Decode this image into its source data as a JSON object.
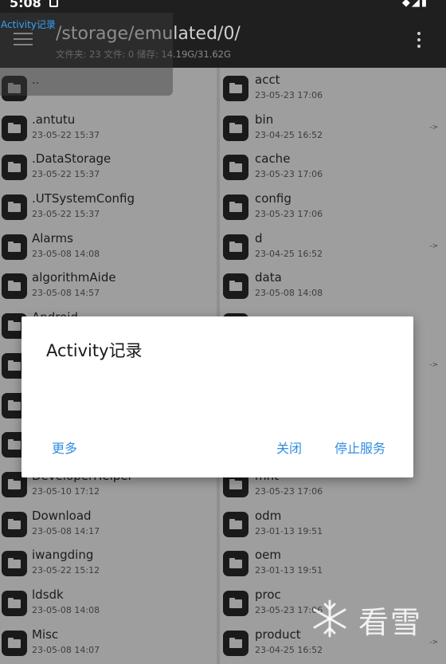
{
  "status_bar": {
    "time": "5:08"
  },
  "toolbar": {
    "path": "/storage/emulated/0/",
    "summary": "文件夹: 23  文件: 0  储存: 14.19G/31.62G"
  },
  "overlay": {
    "label": "Activity记录"
  },
  "left_list": [
    {
      "name": "..",
      "date": ""
    },
    {
      "name": ".antutu",
      "date": "23-05-22 15:37"
    },
    {
      "name": ".DataStorage",
      "date": "23-05-22 15:37"
    },
    {
      "name": ".UTSystemConfig",
      "date": "23-05-22 15:37"
    },
    {
      "name": "Alarms",
      "date": "23-05-08 14:08"
    },
    {
      "name": "algorithmAide",
      "date": "23-05-08 14:57"
    },
    {
      "name": "Android",
      "date": ""
    },
    {
      "name": "",
      "date": ""
    },
    {
      "name": "",
      "date": ""
    },
    {
      "name": "",
      "date": ""
    },
    {
      "name": "DeveloperHelper",
      "date": "23-05-10 17:12"
    },
    {
      "name": "Download",
      "date": "23-05-08 14:17"
    },
    {
      "name": "iwangding",
      "date": "23-05-22 15:12"
    },
    {
      "name": "ldsdk",
      "date": "23-05-08 14:08"
    },
    {
      "name": "Misc",
      "date": "23-05-08 14:07"
    }
  ],
  "right_list": [
    {
      "name": "acct",
      "date": "23-05-23 17:06",
      "arrow": ""
    },
    {
      "name": "bin",
      "date": "23-04-25 16:52",
      "arrow": "->"
    },
    {
      "name": "cache",
      "date": "23-05-23 17:06",
      "arrow": ""
    },
    {
      "name": "config",
      "date": "23-05-23 17:06",
      "arrow": ""
    },
    {
      "name": "d",
      "date": "23-04-25 16:52",
      "arrow": "->"
    },
    {
      "name": "data",
      "date": "23-05-08 14:08",
      "arrow": ""
    },
    {
      "name": "",
      "date": "",
      "arrow": ""
    },
    {
      "name": "",
      "date": "",
      "arrow": "->"
    },
    {
      "name": "",
      "date": "",
      "arrow": ""
    },
    {
      "name": "",
      "date": "",
      "arrow": ""
    },
    {
      "name": "mnt",
      "date": "23-05-23 17:06",
      "arrow": ""
    },
    {
      "name": "odm",
      "date": "23-01-13 19:51",
      "arrow": ""
    },
    {
      "name": "oem",
      "date": "23-01-13 19:51",
      "arrow": ""
    },
    {
      "name": "proc",
      "date": "23-05-23 17:06",
      "arrow": ""
    },
    {
      "name": "product",
      "date": "23-04-25 16:52",
      "arrow": "->"
    }
  ],
  "dialog": {
    "title": "Activity记录",
    "more_label": "更多",
    "close_label": "关闭",
    "stop_label": "停止服务"
  },
  "watermark": {
    "text": "看雪"
  },
  "colors": {
    "accent": "#2f8de4",
    "overlay_text": "#36a3ff",
    "toolbar_bg": "#1f1f1f",
    "list_bg": "#9e9e9e"
  }
}
